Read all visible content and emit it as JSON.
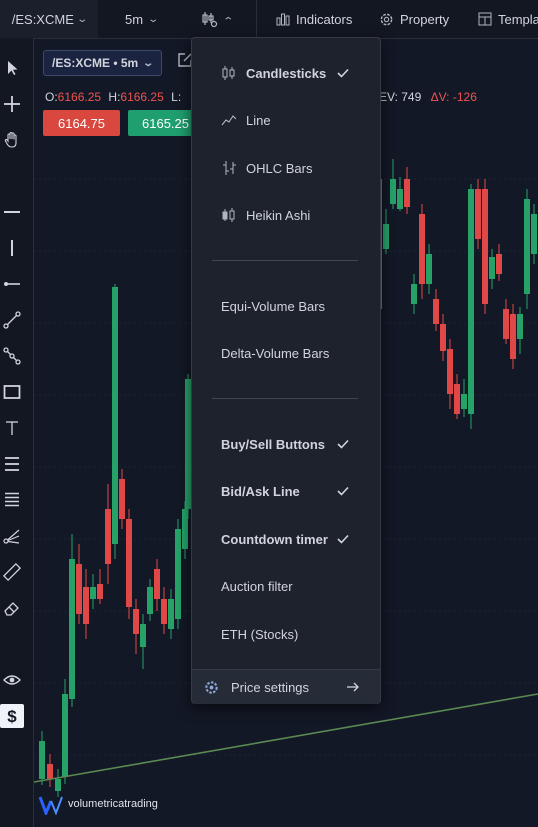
{
  "topbar": {
    "symbol": "/ES:XCME",
    "interval": "5m",
    "indicators_label": "Indicators",
    "property_label": "Property",
    "templates_label": "Templa"
  },
  "chart": {
    "symbol_chip": "/ES:XCME • 5m",
    "ohlc": {
      "o_label": "O:",
      "o": "6166.25",
      "h_label": "H:",
      "h": "6166.25",
      "l_label": "L:"
    },
    "ohlc_right": {
      "ev": "EV: 749",
      "dv": "ΔV: -126"
    },
    "sell_price": "6164.75",
    "buy_price": "6165.25",
    "watermark": "volumetricatrading"
  },
  "menu": {
    "items": [
      {
        "label": "Candlesticks",
        "checked": true,
        "icon": "candlestick-icon"
      },
      {
        "label": "Line",
        "checked": false,
        "icon": "line-chart-icon"
      },
      {
        "label": "OHLC Bars",
        "checked": false,
        "icon": "ohlc-bars-icon"
      },
      {
        "label": "Heikin Ashi",
        "checked": false,
        "icon": "heikin-ashi-icon"
      },
      {
        "label": "Equi-Volume Bars",
        "checked": false
      },
      {
        "label": "Delta-Volume Bars",
        "checked": false
      },
      {
        "label": "Buy/Sell Buttons",
        "checked": true
      },
      {
        "label": "Bid/Ask Line",
        "checked": true
      },
      {
        "label": "Countdown timer",
        "checked": true
      },
      {
        "label": "Auction filter",
        "checked": false
      },
      {
        "label": "ETH (Stocks)",
        "checked": false
      }
    ],
    "footer_label": "Price settings"
  },
  "colors": {
    "up": "#26a269",
    "down": "#e04848",
    "accent": "#2962ff",
    "bg": "#131826"
  }
}
